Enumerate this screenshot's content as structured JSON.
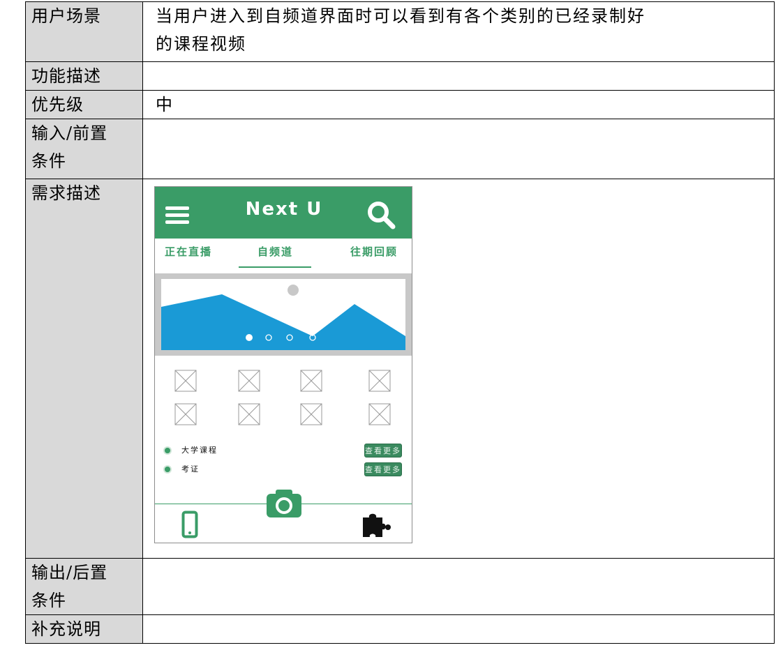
{
  "table": {
    "rows": [
      {
        "label": "用户场景",
        "value_lines": [
          "当用户进入到自频道界面时可以看到有各个类别的已经录制好",
          "的课程视频"
        ]
      },
      {
        "label": "功能描述",
        "value_lines": []
      },
      {
        "label": "优先级",
        "value_lines": [
          "中"
        ]
      },
      {
        "label_lines": [
          "输入/前置",
          "条件"
        ],
        "value_lines": []
      },
      {
        "label": "需求描述",
        "value_lines": []
      },
      {
        "label_lines": [
          "输出/后置",
          "条件"
        ],
        "value_lines": []
      },
      {
        "label": "补充说明",
        "value_lines": []
      }
    ]
  },
  "mockup": {
    "app_title": "Next U",
    "tabs": [
      "正在直播",
      "自频道",
      "往期回顾"
    ],
    "active_tab": 1,
    "banner": {
      "page_count": 4,
      "active_page": 0
    },
    "categories": [
      {
        "name": "大学课程",
        "more_label": "查看更多"
      },
      {
        "name": "考证",
        "more_label": "查看更多"
      }
    ],
    "colors": {
      "brand_green": "#3a9c67",
      "banner_blue": "#1a9ad6",
      "banner_frame": "#c8c8c8",
      "button_green": "#3a8a5f"
    },
    "icons": [
      "menu-icon",
      "search-icon",
      "image-placeholder-icon",
      "phone-icon",
      "camera-icon",
      "puzzle-icon"
    ]
  }
}
